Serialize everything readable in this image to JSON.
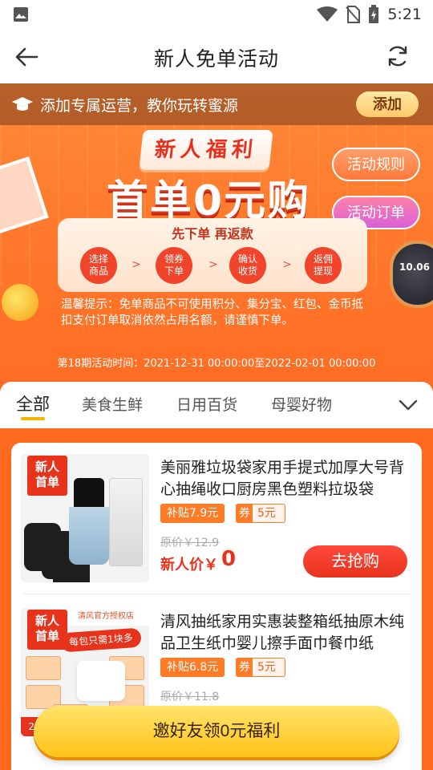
{
  "status_bar": {
    "time": "5:21"
  },
  "title_bar": {
    "title": "新人免单活动"
  },
  "promo": {
    "text": "添加专属运营，教你玩转蜜源",
    "button": "添加"
  },
  "banner": {
    "tag": "新人福利",
    "headline": "首单0元购",
    "rules_button": "活动规则",
    "orders_button": "活动订单",
    "steps_title": "先下单 再返款",
    "steps": [
      "选择\n商品",
      "领券\n下单",
      "确认\n收货",
      "返佣\n提现"
    ],
    "step_arrow": ">",
    "tip": "温馨提示：免单商品不可使用积分、集分宝、红包、金币抵扣支付订单取消依然占用名额，请谨慎下单。",
    "period": "第18期活动时间：2021-12-31 00:00:00至2022-02-01 00:00:00",
    "watch_label": "10.06"
  },
  "tabs": [
    "全部",
    "美食生鲜",
    "日用百货",
    "母婴好物"
  ],
  "products": [
    {
      "badge": "新人\n首单",
      "name": "美丽雅垃圾袋家用手提式加厚大号背心抽绳收口厨房黑色塑料拉圾袋",
      "subsidy": "补贴7.9元",
      "coupon_prefix": "券",
      "coupon_value": "5元",
      "orig_price": "原价￥12.9",
      "new_price_label": "新人价￥",
      "new_price": "0",
      "button": "去抢购"
    },
    {
      "badge": "新人\n首单",
      "name": "清风抽纸家用实惠装整箱纸抽原木纯品卫生纸巾婴儿擦手面巾餐巾纸",
      "subsidy": "补贴6.8元",
      "coupon_prefix": "券",
      "coupon_value": "5元",
      "orig_price": "原价￥11.8",
      "brand_bar": "清风官方授权店",
      "slogan": "每包只需1块多",
      "num_badge": "24"
    }
  ],
  "cta": {
    "label": "邀好友领0元福利"
  },
  "colors": {
    "accent": "#ff6a1f",
    "price_red": "#e8331c",
    "cta_yellow": "#ffc41a",
    "tab_underline": "#f5b400"
  }
}
